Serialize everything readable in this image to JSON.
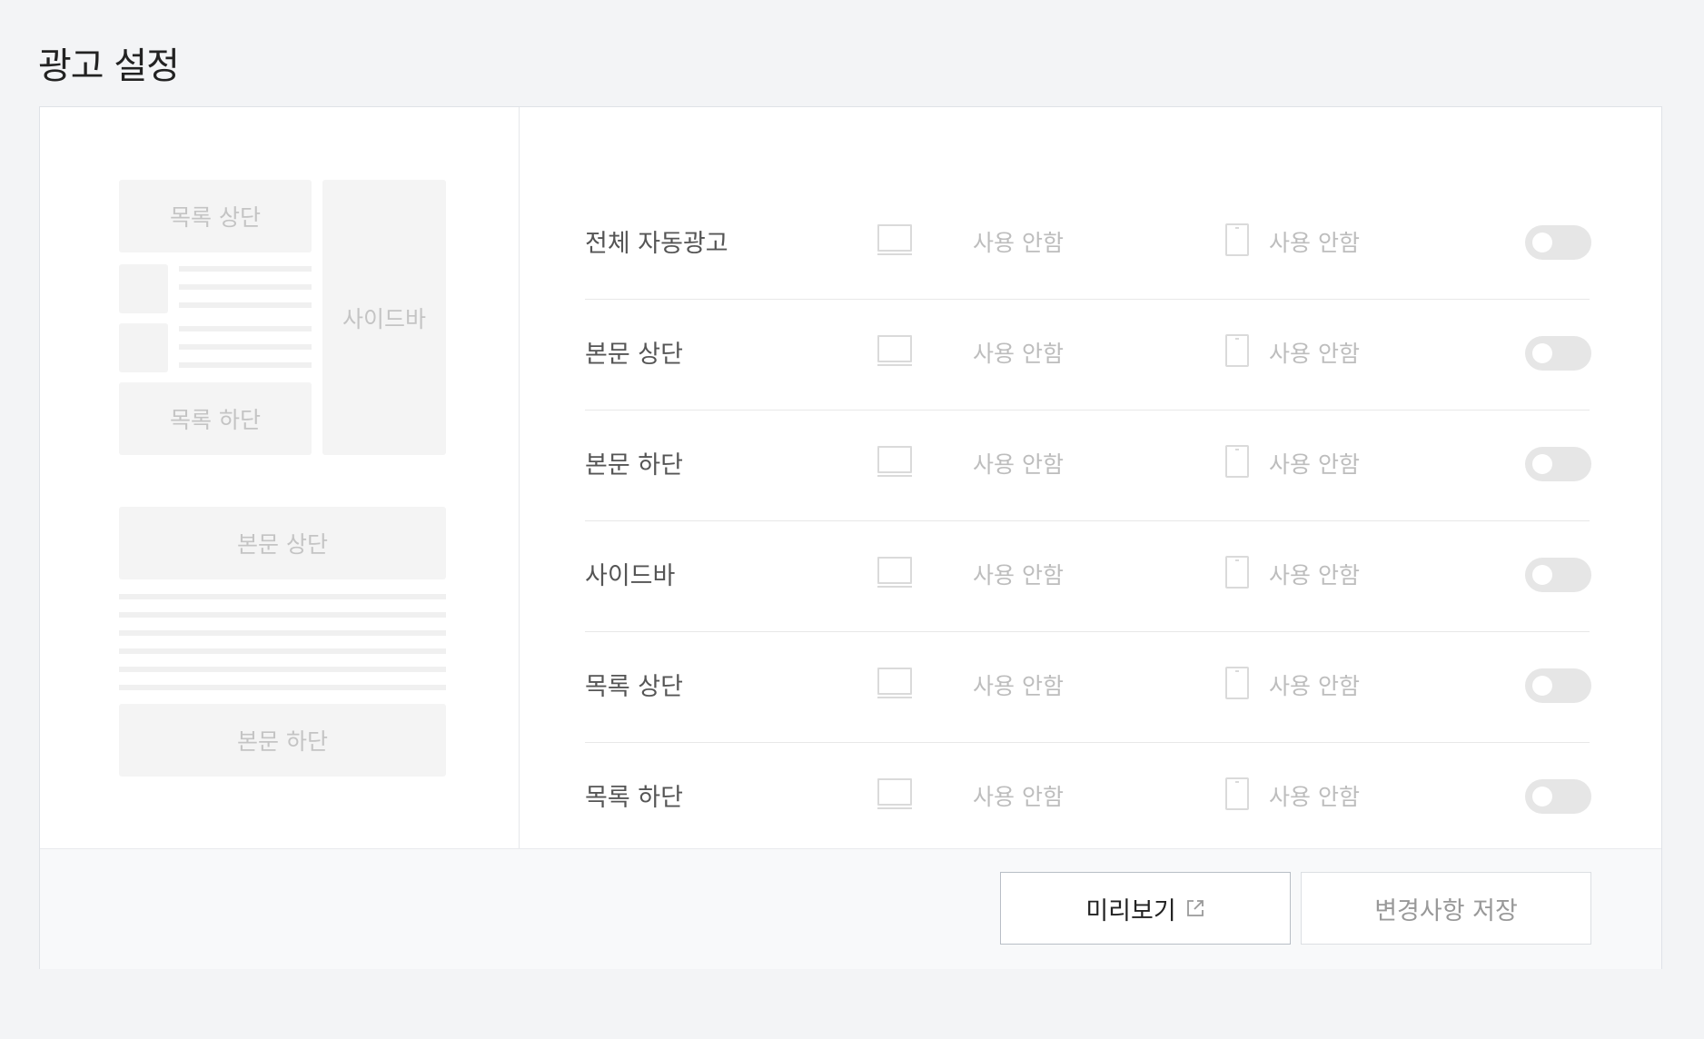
{
  "page": {
    "title": "광고 설정"
  },
  "preview": {
    "list_top": "목록 상단",
    "list_bottom": "목록 하단",
    "sidebar": "사이드바",
    "body_top": "본문 상단",
    "body_bottom": "본문 하단"
  },
  "rows": [
    {
      "label": "전체 자동광고",
      "pc_status": "사용 안함",
      "mobile_status": "사용 안함",
      "enabled": false
    },
    {
      "label": "본문 상단",
      "pc_status": "사용 안함",
      "mobile_status": "사용 안함",
      "enabled": false
    },
    {
      "label": "본문 하단",
      "pc_status": "사용 안함",
      "mobile_status": "사용 안함",
      "enabled": false
    },
    {
      "label": "사이드바",
      "pc_status": "사용 안함",
      "mobile_status": "사용 안함",
      "enabled": false
    },
    {
      "label": "목록 상단",
      "pc_status": "사용 안함",
      "mobile_status": "사용 안함",
      "enabled": false
    },
    {
      "label": "목록 하단",
      "pc_status": "사용 안함",
      "mobile_status": "사용 안함",
      "enabled": false
    }
  ],
  "footer": {
    "preview_label": "미리보기",
    "save_label": "변경사항 저장"
  },
  "icons": {
    "pc": "monitor-icon",
    "mobile": "smartphone-icon",
    "external": "external-link-icon"
  },
  "colors": {
    "background": "#f3f4f6",
    "panel": "#ffffff",
    "toggle_off": "#e6e6e6",
    "muted_text": "#bdbdbd"
  }
}
